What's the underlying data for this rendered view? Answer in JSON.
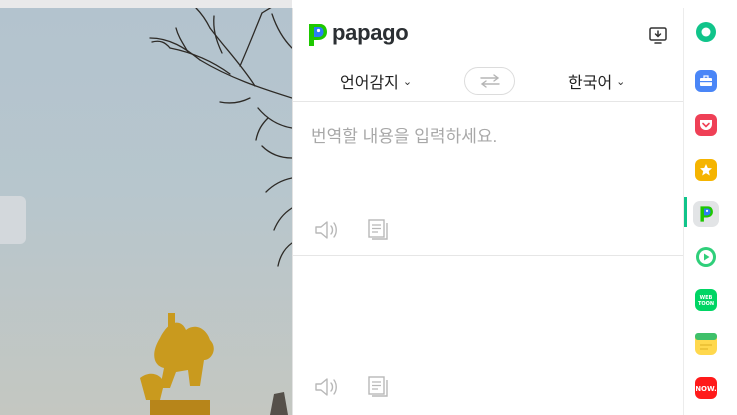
{
  "app": {
    "name": "papago"
  },
  "header": {
    "install_icon": "install-to-desktop-icon"
  },
  "languages": {
    "source": "언어감지",
    "target": "한국어",
    "swap_icon": "swap-arrows-icon"
  },
  "source_box": {
    "placeholder": "번역할 내용을 입력하세요.",
    "value": "",
    "speaker_icon": "speaker-icon",
    "copy_icon": "copy-icon"
  },
  "target_box": {
    "speaker_icon": "speaker-icon",
    "copy_icon": "copy-icon"
  },
  "sidebar": {
    "items": [
      {
        "icon": "naver-whale-green-icon",
        "color": "#10c48a"
      },
      {
        "icon": "briefcase-icon",
        "color": "#4a86f7"
      },
      {
        "icon": "pocket-icon",
        "color": "#ef4056"
      },
      {
        "icon": "star-icon",
        "color": "#f5b400"
      },
      {
        "icon": "papago-icon",
        "color": "#1ec800",
        "active": true
      },
      {
        "icon": "play-icon",
        "color": "#2fcf7a"
      },
      {
        "icon": "webtoon-icon",
        "color": "#00d564"
      },
      {
        "icon": "memo-icon",
        "color": "#ffd84d"
      },
      {
        "icon": "now-icon",
        "color": "#ff1a1a"
      }
    ]
  },
  "colors": {
    "accent": "#10c48a",
    "placeholder": "#a8a8a8"
  }
}
